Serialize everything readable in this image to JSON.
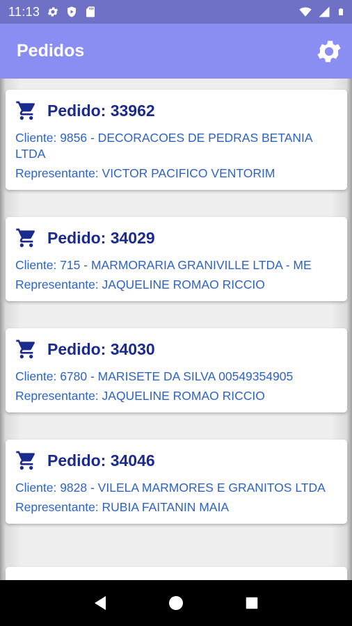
{
  "status_bar": {
    "time": "11:13",
    "left_icons": [
      "gear-icon",
      "shield-icon",
      "sd-card-icon"
    ],
    "right_icons": [
      "wifi-icon",
      "cell-signal-icon",
      "battery-icon"
    ]
  },
  "app_bar": {
    "title": "Pedidos",
    "settings_icon": "gear-icon"
  },
  "orders": [
    {
      "title": "Pedido: 33962",
      "client": "Cliente: 9856 - DECORACOES DE PEDRAS BETANIA LTDA",
      "rep": "Representante: VICTOR PACIFICO VENTORIM"
    },
    {
      "title": "Pedido: 34029",
      "client": "Cliente: 715 - MARMORARIA GRANIVILLE LTDA - ME",
      "rep": "Representante: JAQUELINE ROMAO RICCIO"
    },
    {
      "title": "Pedido: 34030",
      "client": "Cliente: 6780 - MARISETE DA SILVA 00549354905",
      "rep": "Representante: JAQUELINE ROMAO RICCIO"
    },
    {
      "title": "Pedido: 34046",
      "client": "Cliente: 9828 - VILELA MARMORES E GRANITOS LTDA",
      "rep": "Representante: RUBIA FAITANIN MAIA"
    }
  ],
  "nav_bar": {
    "buttons": [
      "back-icon",
      "home-icon",
      "recents-icon"
    ]
  },
  "colors": {
    "status_bar": "#6e71c6",
    "app_bar": "#8a8ef3",
    "order_title": "#1b2a8f",
    "detail_text": "#2c63c4"
  }
}
